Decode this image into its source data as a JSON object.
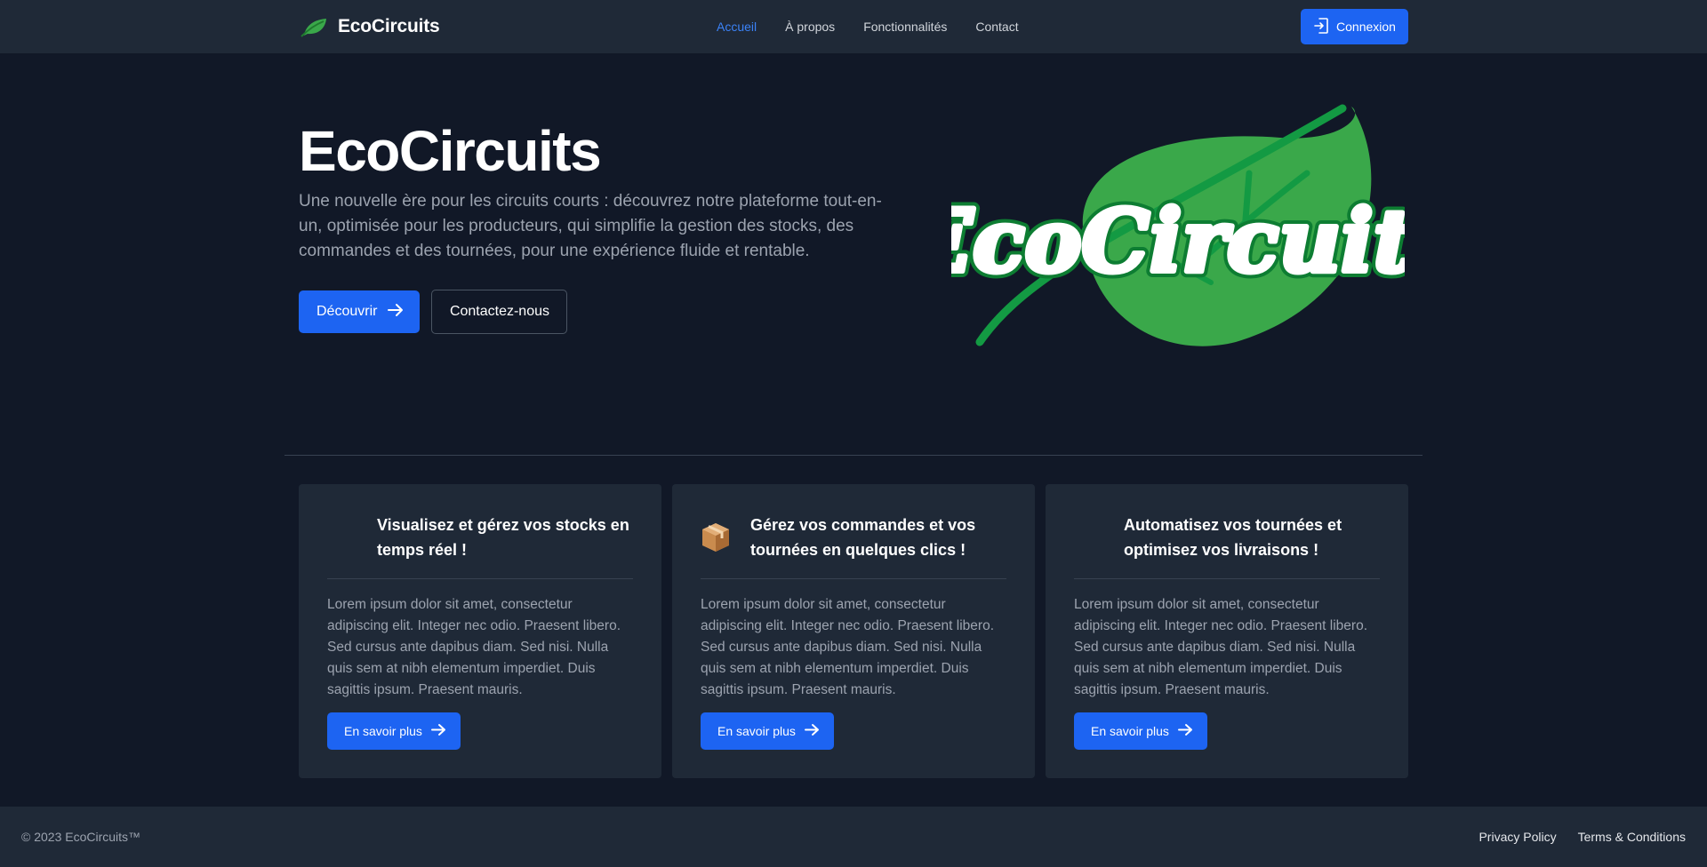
{
  "navbar": {
    "brand": "EcoCircuits",
    "brand_icon": "leaf-icon",
    "links": [
      {
        "label": "Accueil",
        "active": true
      },
      {
        "label": "À propos",
        "active": false
      },
      {
        "label": "Fonctionnalités",
        "active": false
      },
      {
        "label": "Contact",
        "active": false
      }
    ],
    "login_label": "Connexion",
    "login_icon": "login-icon"
  },
  "hero": {
    "title": "EcoCircuits",
    "description": "Une nouvelle ère pour les circuits courts : découvrez notre plateforme tout-en-un, optimisée pour les producteurs, qui simplifie la gestion des stocks, des commandes et des tournées, pour une expérience fluide et rentable.",
    "primary_label": "Découvrir",
    "secondary_label": "Contactez-nous",
    "logo_text": "EcoCircuits"
  },
  "cards": [
    {
      "icon": "stock-icon",
      "title": "Visualisez et gérez vos stocks en temps réel !",
      "text": "Lorem ipsum dolor sit amet, consectetur adipiscing elit. Integer nec odio. Praesent libero. Sed cursus ante dapibus diam. Sed nisi. Nulla quis sem at nibh elementum imperdiet. Duis sagittis ipsum. Praesent mauris.",
      "button": "En savoir plus"
    },
    {
      "icon": "package-icon",
      "title": "Gérez vos commandes et vos tournées en quelques clics !",
      "text": "Lorem ipsum dolor sit amet, consectetur adipiscing elit. Integer nec odio. Praesent libero. Sed cursus ante dapibus diam. Sed nisi. Nulla quis sem at nibh elementum imperdiet. Duis sagittis ipsum. Praesent mauris.",
      "button": "En savoir plus"
    },
    {
      "icon": "delivery-icon",
      "title": "Automatisez vos tournées et optimisez vos livraisons !",
      "text": "Lorem ipsum dolor sit amet, consectetur adipiscing elit. Integer nec odio. Praesent libero. Sed cursus ante dapibus diam. Sed nisi. Nulla quis sem at nibh elementum imperdiet. Duis sagittis ipsum. Praesent mauris.",
      "button": "En savoir plus"
    }
  ],
  "footer": {
    "copyright": "© 2023 EcoCircuits™",
    "links": [
      "Privacy Policy",
      "Terms & Conditions"
    ]
  },
  "colors": {
    "background": "#111827",
    "surface": "#1f2937",
    "accent": "#1d64f2",
    "active_link": "#3b82f6",
    "leaf_green": "#3aa84a"
  }
}
